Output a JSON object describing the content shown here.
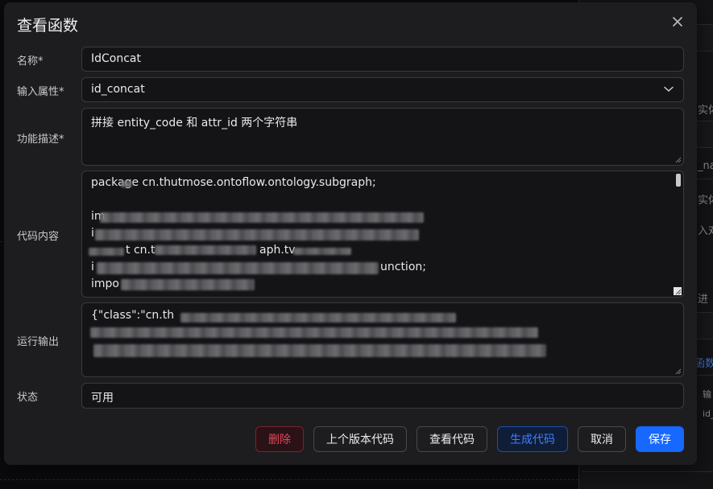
{
  "background": {
    "texts": [
      "实体",
      "_na",
      "实体",
      "入对",
      "进",
      "函数",
      "输",
      "id_"
    ]
  },
  "modal": {
    "title": "查看函数",
    "close_icon": "close-icon",
    "fields": {
      "name": {
        "label": "名称*",
        "value": "IdConcat"
      },
      "input_attr": {
        "label": "输入属性*",
        "value": "id_concat"
      },
      "description": {
        "label": "功能描述*",
        "value": "拼接 entity_code 和 attr_id 两个字符串"
      },
      "code": {
        "label": "代码内容",
        "lines": [
          "package cn.thutmose.ontoflow.ontology.subgraph;",
          "",
          "im",
          "i",
          "t cn.t",
          "i",
          "impo"
        ],
        "fragments": [
          "aph.tv",
          "unction;"
        ]
      },
      "output": {
        "label": "运行输出",
        "lines": [
          "{\"class\":\"cn.th",
          "",
          ""
        ]
      },
      "status": {
        "label": "状态",
        "value": "可用"
      }
    },
    "buttons": {
      "delete": "删除",
      "prev_version": "上个版本代码",
      "view_code": "查看代码",
      "generate_code": "生成代码",
      "cancel": "取消",
      "save": "保存"
    }
  }
}
